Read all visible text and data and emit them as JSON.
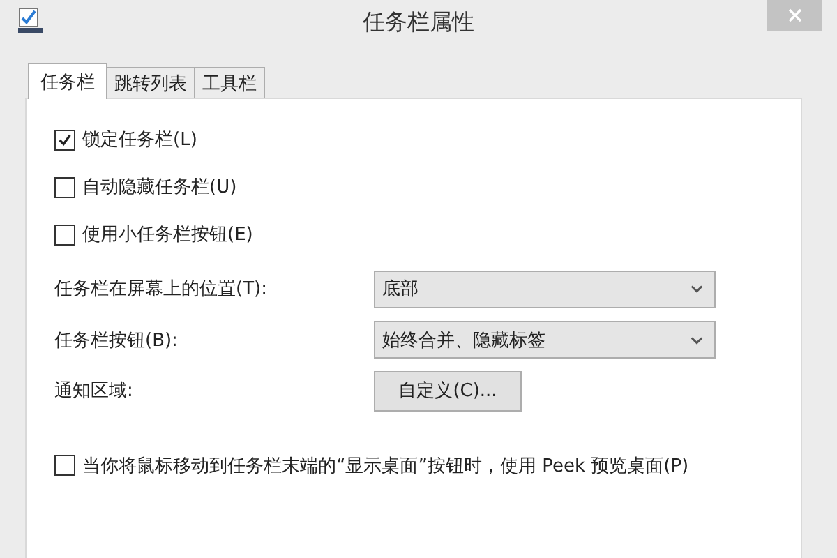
{
  "window": {
    "title": "任务栏属性"
  },
  "tabs": [
    {
      "label": "任务栏",
      "selected": true
    },
    {
      "label": "跳转列表",
      "selected": false
    },
    {
      "label": "工具栏",
      "selected": false
    }
  ],
  "options": [
    {
      "label": "锁定任务栏(L)",
      "checked": true
    },
    {
      "label": "自动隐藏任务栏(U)",
      "checked": false
    },
    {
      "label": "使用小任务栏按钮(E)",
      "checked": false
    }
  ],
  "settings": [
    {
      "kind": "dropdown",
      "label": "任务栏在屏幕上的位置(T):",
      "value": "底部"
    },
    {
      "kind": "dropdown",
      "label": "任务栏按钮(B):",
      "value": "始终合并、隐藏标签"
    },
    {
      "kind": "button",
      "label": "通知区域:",
      "value": "自定义(C)..."
    }
  ],
  "peek": {
    "label": "当你将鼠标移动到任务栏末端的“显示桌面”按钮时，使用 Peek 预览桌面(P)",
    "checked": false
  }
}
